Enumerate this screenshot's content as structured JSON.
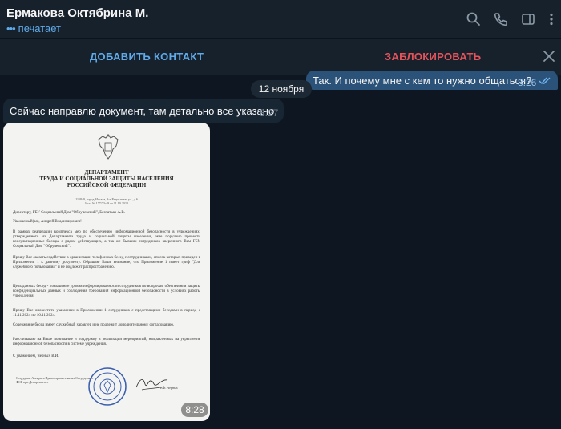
{
  "header": {
    "contact_name": "Ермакова Октябрина М.",
    "status": "печатает",
    "icons": [
      "search-icon",
      "phone-icon",
      "sidebar-icon",
      "more-vertical-icon"
    ]
  },
  "action_bar": {
    "add_contact": "ДОБАВИТЬ КОНТАКТ",
    "block": "ЗАБЛОКИРОВАТЬ"
  },
  "messages": [
    {
      "direction": "outgoing",
      "text": "Так. И почему мне с кем то нужно общаться?",
      "time": "8:26",
      "status": "read"
    },
    {
      "type": "date",
      "text": "12 ноября"
    },
    {
      "direction": "incoming",
      "text": "Сейчас направлю документ, там детально все указано.",
      "time": "8:27"
    },
    {
      "direction": "incoming",
      "type": "photo",
      "time": "8:28"
    }
  ],
  "document": {
    "dept_line1": "ДЕПАРТАМЕНТ",
    "dept_line2": "ТРУДА И СОЦИАЛЬНОЙ ЗАЩИТЫ НАСЕЛЕНИЯ",
    "dept_line3": "РОССИЙСКОЙ ФЕДЕРАЦИИ",
    "address": "115849, город Москва, 3-я Радиальная ул., д.6",
    "ref": "Исх. № 177/73-49 от 11.10.2024",
    "to": "Директору, ГБУ Социальный Дом \"Обручевский\", Безпатько А.В.",
    "greeting": "Уважаемый(ая), Андрей Владимирович!",
    "p1": "В рамках реализации комплекса мер по обеспечению информационной безопасности в учреждениях, утвержденного из Департамента труда и социальной защиты населения, мне поручено провести консультационные беседы с рядом действующих, а так же бывших сотрудников вверенного Вам ГБУ Социальный Дом \"Обручевский\".",
    "p2": "Прошу Вас оказать содействие в организации телефонных бесед с сотрудниками, список которых приведен в Приложении 1 к данному документу. Обращаю Ваше внимание, что Приложение 1 имеет гриф \"Для служебного пользования\" и не подлежит распространению.",
    "p3": "Цель данных бесед - повышение уровня информированности сотрудников по вопросам обеспечения защиты конфиденциальных данных и соблюдения требований информационной безопасности в условиях работы учреждения.",
    "p4": "Прошу Вас оповестить указанных в Приложении 1 сотрудников с предстоящими беседами в период с 11.11.2024 по 16.11.2024.",
    "p5": "Содержание бесед имеет служебный характер и не подлежит дополнительному согласованию.",
    "p6": "Рассчитываю на Ваше понимание и поддержку в реализации мероприятий, направленных на укрепление информационной безопасности в системе учреждения.",
    "closing": "С уважением, Черных В.И.",
    "sig_block": "Сотрудник Аппарата Правоохранительных Сотрудников ФСБ при Департаменте",
    "sig_name": "В.И. Черных"
  }
}
